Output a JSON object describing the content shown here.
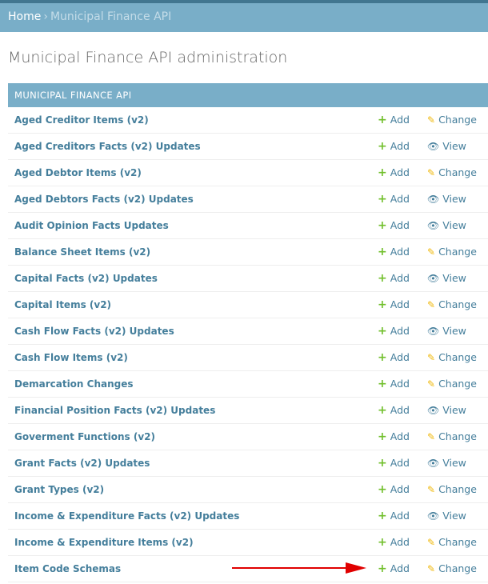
{
  "breadcrumb": {
    "home": "Home",
    "separator": "›",
    "current": "Municipal Finance API"
  },
  "page_title": "Municipal Finance API administration",
  "module": {
    "caption": "MUNICIPAL FINANCE API",
    "add_label": "Add",
    "rows": [
      {
        "name": "Aged Creditor Items (v2)",
        "action": "Change",
        "icon": "pencil-icon"
      },
      {
        "name": "Aged Creditors Facts (v2) Updates",
        "action": "View",
        "icon": "eye-icon"
      },
      {
        "name": "Aged Debtor Items (v2)",
        "action": "Change",
        "icon": "pencil-icon"
      },
      {
        "name": "Aged Debtors Facts (v2) Updates",
        "action": "View",
        "icon": "eye-icon"
      },
      {
        "name": "Audit Opinion Facts Updates",
        "action": "View",
        "icon": "eye-icon"
      },
      {
        "name": "Balance Sheet Items (v2)",
        "action": "Change",
        "icon": "pencil-icon"
      },
      {
        "name": "Capital Facts (v2) Updates",
        "action": "View",
        "icon": "eye-icon"
      },
      {
        "name": "Capital Items (v2)",
        "action": "Change",
        "icon": "pencil-icon"
      },
      {
        "name": "Cash Flow Facts (v2) Updates",
        "action": "View",
        "icon": "eye-icon"
      },
      {
        "name": "Cash Flow Items (v2)",
        "action": "Change",
        "icon": "pencil-icon"
      },
      {
        "name": "Demarcation Changes",
        "action": "Change",
        "icon": "pencil-icon"
      },
      {
        "name": "Financial Position Facts (v2) Updates",
        "action": "View",
        "icon": "eye-icon"
      },
      {
        "name": "Goverment Functions (v2)",
        "action": "Change",
        "icon": "pencil-icon"
      },
      {
        "name": "Grant Facts (v2) Updates",
        "action": "View",
        "icon": "eye-icon"
      },
      {
        "name": "Grant Types (v2)",
        "action": "Change",
        "icon": "pencil-icon"
      },
      {
        "name": "Income & Expenditure Facts (v2) Updates",
        "action": "View",
        "icon": "eye-icon"
      },
      {
        "name": "Income & Expenditure Items (v2)",
        "action": "Change",
        "icon": "pencil-icon"
      },
      {
        "name": "Item Code Schemas",
        "action": "Change",
        "icon": "pencil-icon"
      }
    ]
  },
  "colors": {
    "header_bg": "#79aec8",
    "header_border": "#417690",
    "link": "#447e9b",
    "add_icon": "#70bf2b",
    "change_icon": "#efb80b",
    "arrow": "#e00000"
  }
}
